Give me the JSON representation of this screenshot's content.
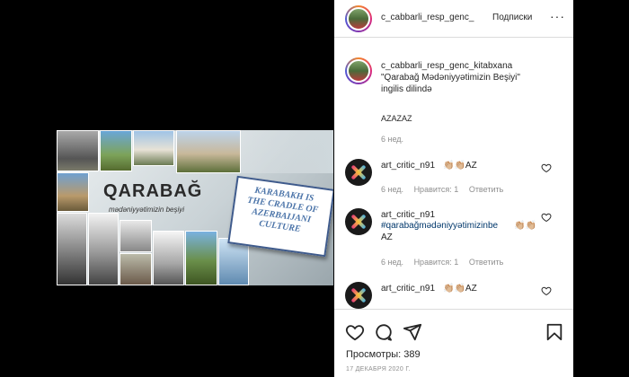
{
  "post_image": {
    "title": "QARABAĞ",
    "subtitle": "mədəniyyətimizin beşiyi",
    "banner_lines": [
      "KARABAKH IS",
      "THE CRADLE OF",
      "AZERBAIJANI",
      "CULTURE"
    ]
  },
  "header": {
    "username": "c_cabbarli_resp_genc_",
    "follow_label": "Подписки",
    "more_icon": "more-icon"
  },
  "caption": {
    "username": "c_cabbarli_resp_genc_kitabxana",
    "line1": "\"Qarabağ Mədəniyyətimizin Beşiyi\"",
    "line2": "ingilis dilində",
    "tag": "AZAZAZ",
    "time": "6 нед."
  },
  "comments": [
    {
      "username": "art_critic_n91",
      "text": "👏🏼👏🏼AZ",
      "time": "6 нед.",
      "likes": "Нравится: 1",
      "reply": "Ответить"
    },
    {
      "username": "art_critic_n91",
      "hashtag": "#qarabağmədəniyyətimizinbe",
      "text": "👏🏼👏🏼",
      "text2": "AZ",
      "time": "6 нед.",
      "likes": "Нравится: 1",
      "reply": "Ответить"
    },
    {
      "username": "art_critic_n91",
      "text": "👏🏼👏🏼AZ"
    }
  ],
  "footer": {
    "views": "Просмотры: 389",
    "date": "17 ДЕКАБРЯ 2020 Г."
  }
}
